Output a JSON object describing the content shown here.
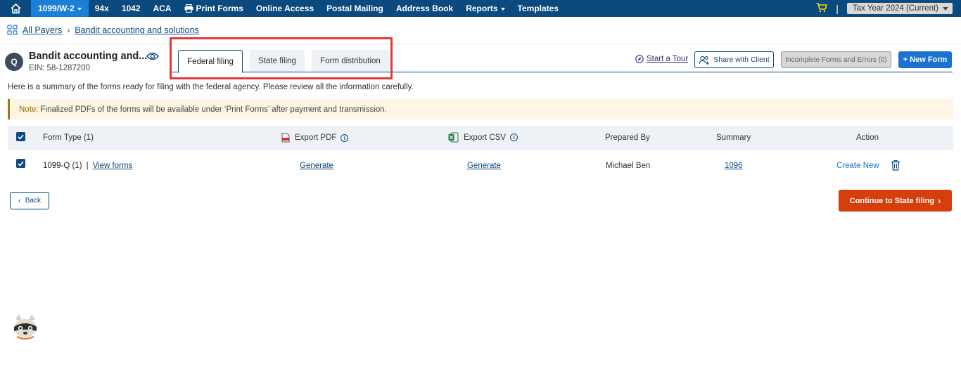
{
  "topnav": {
    "active_item": "1099/W-2",
    "items": [
      "94x",
      "1042",
      "ACA",
      "Print Forms",
      "Online Access",
      "Postal Mailing",
      "Address Book",
      "Reports",
      "Templates"
    ],
    "separator": "|",
    "tax_year": "Tax Year 2024 (Current)"
  },
  "breadcrumb": {
    "root": "All Payers",
    "current": "Bandit accounting and solutions"
  },
  "payer": {
    "initial": "Q",
    "name": "Bandit accounting and...",
    "ein": "EIN: 58-1287200"
  },
  "tabs": {
    "federal": "Federal filing",
    "state": "State filing",
    "distribution": "Form distribution"
  },
  "actions": {
    "tour": "Start a Tour",
    "share": "Share with Client",
    "incomplete": "Incomplete Forms and Errors (0)",
    "new_form": "+ New Form"
  },
  "summary_text": "Here is a summary of the forms ready for filing with the federal agency. Please review all the information carefully.",
  "note": {
    "label": "Note:",
    "text": "Finalized PDFs of the forms will be available under ‘Print Forms’ after payment and transmission."
  },
  "table": {
    "headers": {
      "form_type": "Form Type  (1)",
      "export_pdf": "Export PDF",
      "export_csv": "Export CSV",
      "prepared_by": "Prepared By",
      "summary": "Summary",
      "action": "Action"
    },
    "row": {
      "form": "1099-Q (1)",
      "sep": "|",
      "view": "View forms",
      "pdf": "Generate",
      "csv": "Generate",
      "prepared_by": "Michael Ben",
      "summary": "1096",
      "create": "Create New"
    }
  },
  "buttons": {
    "back": "Back",
    "continue": "Continue to State filing"
  },
  "colors": {
    "nav": "#0b4a7f",
    "nav_active": "#1a7fd6",
    "primary": "#1a73d0",
    "continue": "#d53f0b",
    "highlight": "#e0393b"
  }
}
